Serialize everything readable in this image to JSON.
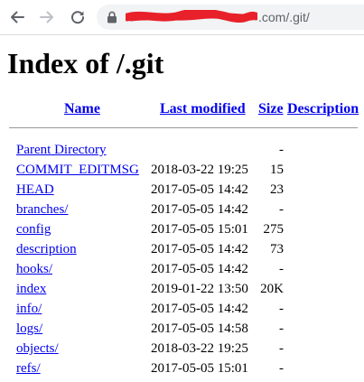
{
  "browser": {
    "url_visible": ".com/.git/",
    "url_redacted_color": "#e8202a"
  },
  "page": {
    "title": "Index of /.git"
  },
  "table": {
    "headers": {
      "name": "Name",
      "last_modified": "Last modified",
      "size": "Size",
      "description": "Description"
    },
    "rows": [
      {
        "name": "Parent Directory",
        "modified": "",
        "size": "-",
        "description": ""
      },
      {
        "name": "COMMIT_EDITMSG",
        "modified": "2018-03-22 19:25",
        "size": "15",
        "description": ""
      },
      {
        "name": "HEAD",
        "modified": "2017-05-05 14:42",
        "size": "23",
        "description": ""
      },
      {
        "name": "branches/",
        "modified": "2017-05-05 14:42",
        "size": "-",
        "description": ""
      },
      {
        "name": "config",
        "modified": "2017-05-05 15:01",
        "size": "275",
        "description": ""
      },
      {
        "name": "description",
        "modified": "2017-05-05 14:42",
        "size": "73",
        "description": ""
      },
      {
        "name": "hooks/",
        "modified": "2017-05-05 14:42",
        "size": "-",
        "description": ""
      },
      {
        "name": "index",
        "modified": "2019-01-22 13:50",
        "size": "20K",
        "description": ""
      },
      {
        "name": "info/",
        "modified": "2017-05-05 14:42",
        "size": "-",
        "description": ""
      },
      {
        "name": "logs/",
        "modified": "2017-05-05 14:58",
        "size": "-",
        "description": ""
      },
      {
        "name": "objects/",
        "modified": "2018-03-22 19:25",
        "size": "-",
        "description": ""
      },
      {
        "name": "refs/",
        "modified": "2017-05-05 15:01",
        "size": "-",
        "description": ""
      }
    ]
  }
}
